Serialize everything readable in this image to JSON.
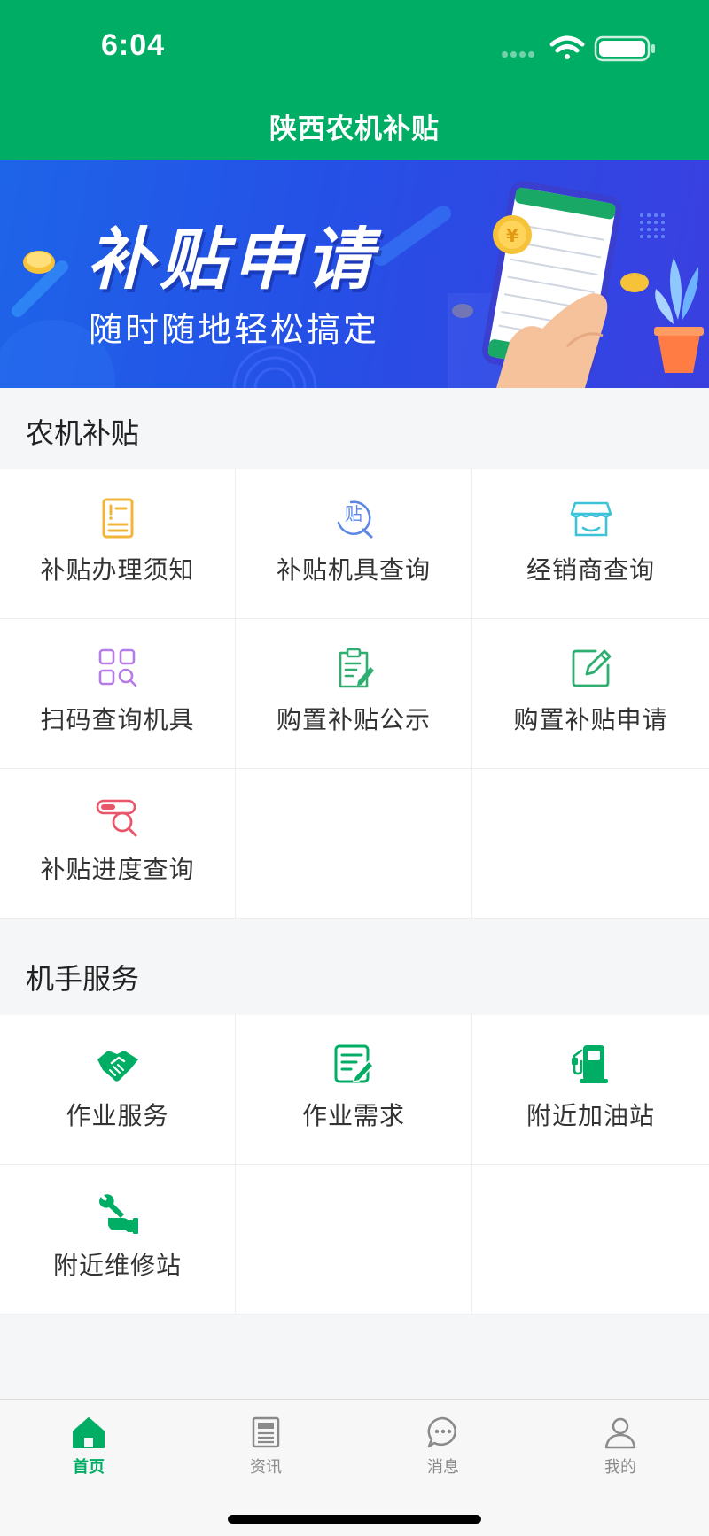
{
  "status_bar": {
    "time": "6:04"
  },
  "header": {
    "title": "陕西农机补贴"
  },
  "banner": {
    "title": "补贴申请",
    "subtitle": "随时随地轻松搞定"
  },
  "sections": [
    {
      "title": "农机补贴",
      "items": [
        {
          "label": "补贴办理须知",
          "icon": "notice-document-icon",
          "color": "#f2b53a"
        },
        {
          "label": "补贴机具查询",
          "icon": "subsidy-search-icon",
          "color": "#5b86e5"
        },
        {
          "label": "经销商查询",
          "icon": "store-icon",
          "color": "#3cc3d8"
        },
        {
          "label": "扫码查询机具",
          "icon": "scan-grid-search-icon",
          "color": "#b57be6"
        },
        {
          "label": "购置补贴公示",
          "icon": "clipboard-edit-icon",
          "color": "#2fae72"
        },
        {
          "label": "购置补贴申请",
          "icon": "edit-square-icon",
          "color": "#2fae72"
        },
        {
          "label": "补贴进度查询",
          "icon": "progress-search-icon",
          "color": "#e9566a"
        }
      ]
    },
    {
      "title": "机手服务",
      "items": [
        {
          "label": "作业服务",
          "icon": "handshake-icon",
          "color": "#00ad64"
        },
        {
          "label": "作业需求",
          "icon": "document-edit-icon",
          "color": "#00ad64"
        },
        {
          "label": "附近加油站",
          "icon": "gas-station-icon",
          "color": "#00ad64"
        },
        {
          "label": "附近维修站",
          "icon": "wrench-hand-icon",
          "color": "#00ad64"
        }
      ]
    }
  ],
  "tabbar": {
    "items": [
      {
        "label": "首页",
        "icon": "home-icon",
        "active": true
      },
      {
        "label": "资讯",
        "icon": "news-icon",
        "active": false
      },
      {
        "label": "消息",
        "icon": "message-icon",
        "active": false
      },
      {
        "label": "我的",
        "icon": "profile-icon",
        "active": false
      }
    ]
  },
  "colors": {
    "brand_green": "#00ad64",
    "banner_blue": "#2550e6"
  }
}
